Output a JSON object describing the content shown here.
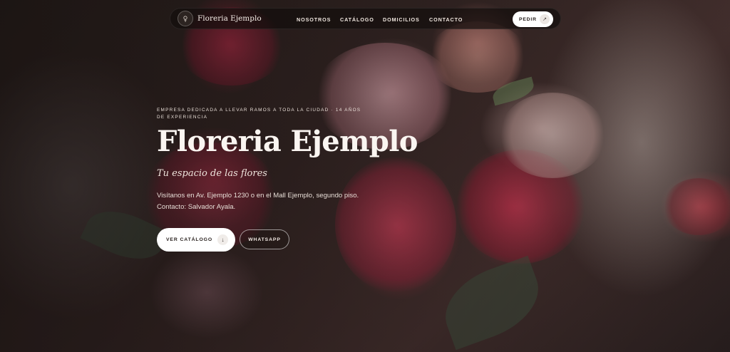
{
  "nav": {
    "brand": "Floreria Ejemplo",
    "links": [
      "NOSOTROS",
      "CATÁLOGO",
      "DOMICILIOS",
      "CONTACTO"
    ],
    "order_button": "PEDIR",
    "order_icon": "arrow-up-right-icon"
  },
  "hero": {
    "kicker": "EMPRESA DEDICADA A LLEVAR RAMOS A TODA LA CIUDAD · 14 AÑOS DE EXPERIENCIA",
    "title": "Floreria Ejemplo",
    "subtitle": "Tu espacio de las flores",
    "lines": [
      "Visítanos en Av. Ejemplo 1230 o en el Mall Ejemplo, segundo piso.",
      "Contacto: Salvador Ayala."
    ],
    "primary_cta": "VER CATÁLOGO",
    "primary_cta_icon": "arrow-down-icon",
    "secondary_cta": "WHATSAPP"
  },
  "colors": {
    "nav_background": "#140e0c",
    "button_background": "#ffffff",
    "text_light": "#faf5f1",
    "rose": "#c42e48"
  }
}
